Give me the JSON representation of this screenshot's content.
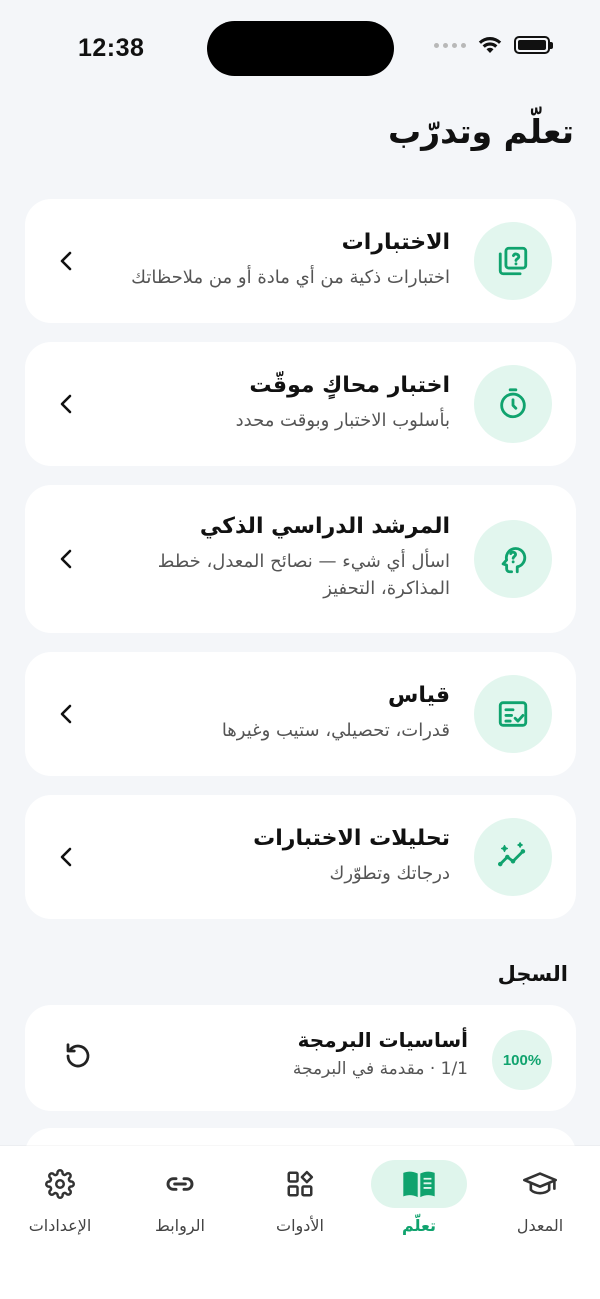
{
  "status_bar": {
    "time": "12:38"
  },
  "page_title": "تعلّم وتدرّب",
  "accent_color": "#10a36e",
  "cards": [
    {
      "icon": "quiz-icon",
      "title": "الاختبارات",
      "subtitle": "اختبارات ذكية من أي مادة أو من ملاحظاتك"
    },
    {
      "icon": "timer-icon",
      "title": "اختبار محاكٍ موقّت",
      "subtitle": "بأسلوب الاختبار وبوقت محدد"
    },
    {
      "icon": "brain-icon",
      "title": "المرشد الدراسي الذكي",
      "subtitle": "اسأل أي شيء — نصائح المعدل، خطط المذاكرة، التحفيز"
    },
    {
      "icon": "checklist-icon",
      "title": "قياس",
      "subtitle": "قدرات، تحصيلي، ستيب وغيرها"
    },
    {
      "icon": "analytics-icon",
      "title": "تحليلات الاختبارات",
      "subtitle": "درجاتك وتطوّرك"
    }
  ],
  "history": {
    "label": "السجل",
    "items": [
      {
        "badge": "100%",
        "title": "أساسيات البرمجة",
        "subtitle": "1/1 · مقدمة في البرمجة"
      }
    ]
  },
  "tabs": [
    {
      "label": "المعدل",
      "icon": "graduation-cap-icon",
      "active": false
    },
    {
      "label": "تعلّم",
      "icon": "book-icon",
      "active": true
    },
    {
      "label": "الأدوات",
      "icon": "tools-grid-icon",
      "active": false
    },
    {
      "label": "الروابط",
      "icon": "link-icon",
      "active": false
    },
    {
      "label": "الإعدادات",
      "icon": "gear-icon",
      "active": false
    }
  ]
}
